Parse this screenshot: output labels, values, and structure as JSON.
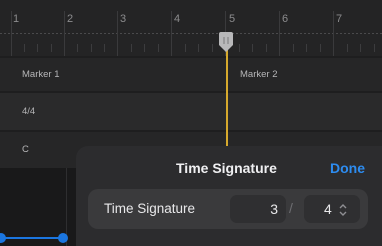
{
  "ruler": {
    "bars": [
      "1",
      "2",
      "3",
      "4",
      "5",
      "6",
      "7"
    ]
  },
  "tracks": {
    "marker_track": {
      "label": "Marker 1",
      "marker_2": "Marker 2"
    },
    "signature_track": {
      "label": "4/4"
    },
    "chord_track": {
      "label": "C"
    }
  },
  "sheet": {
    "title": "Time Signature",
    "done_label": "Done",
    "field_label": "Time Signature",
    "numerator": "3",
    "separator": "/",
    "denominator": "4"
  },
  "colors": {
    "accent": "#2d8cf0",
    "playhead": "#d6a92d",
    "blue_track": "#1b76e0"
  },
  "icons": {
    "playhead": "playhead-handle-icon",
    "stepper": "chevron-up-down-icon"
  }
}
